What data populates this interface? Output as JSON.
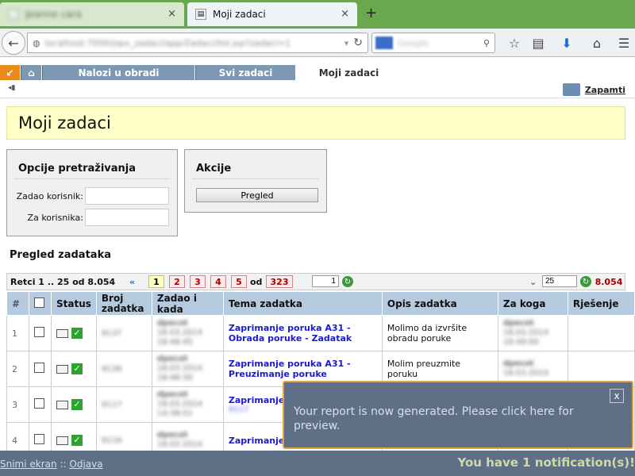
{
  "browser": {
    "tabs": [
      {
        "title": "Jeanne cara",
        "close": "×"
      },
      {
        "title": "Moji zadaci",
        "close": "×"
      }
    ],
    "new_tab": "+",
    "url": "localhost:7000/jspx_zadaci/app/Zadaci/list.jsp?zadaci=1",
    "search_placeholder": "Google"
  },
  "app_tabs": [
    {
      "label": "Nalozi u obradi"
    },
    {
      "label": "Svi zadaci"
    },
    {
      "label": "Moji zadaci"
    }
  ],
  "toolbar": {
    "save_label": "Zapamti"
  },
  "page_title": "Moji zadaci",
  "search_panel": {
    "title": "Opcije pretraživanja",
    "fields": [
      {
        "label": "Zadao korisnik:",
        "value": ""
      },
      {
        "label": "Za korisnika:",
        "value": ""
      }
    ]
  },
  "actions_panel": {
    "title": "Akcije",
    "button": "Pregled"
  },
  "section_title": "Pregled zadataka",
  "pager": {
    "rows_info": "Retci 1 .. 25 od 8.054",
    "pages": [
      "1",
      "2",
      "3",
      "4",
      "5"
    ],
    "of_label": "od",
    "total_pages": "323",
    "goto_value": "1",
    "page_size": "25",
    "total_rows": "8.054"
  },
  "table": {
    "columns": [
      "#",
      "",
      "Status",
      "Broj zadatka",
      "Zadao i kada",
      "Tema zadatka",
      "Opis zadatka",
      "Za koga",
      "Rješenje"
    ],
    "rows": [
      {
        "num": "1",
        "broj": "9137",
        "zadao": "dpecot",
        "kada": "18.03.2014 18:48:45",
        "tema": "Zaprimanje poruka A31 - Obrada poruke - Zadatak",
        "tema_extra": "",
        "opis": "Molimo da izvršite obradu poruke",
        "za": "dpecot",
        "za_kada": "18.03.2014 18:49:00"
      },
      {
        "num": "2",
        "broj": "9136",
        "zadao": "dpecot",
        "kada": "18.03.2014 18:48:30",
        "tema": "Zaprimanje poruka A31 - Preuzimanje poruke",
        "tema_extra": "",
        "opis": "Molim preuzmite poruku",
        "za": "dpecot",
        "za_kada": "18.03.2014"
      },
      {
        "num": "3",
        "broj": "9117",
        "zadao": "dpecot",
        "kada": "18.03.2014 14:38:51",
        "tema": "Zaprimanje p",
        "tema_extra": "9117",
        "opis": "",
        "za": "",
        "za_kada": ""
      },
      {
        "num": "4",
        "broj": "9116",
        "zadao": "dpecot",
        "kada": "18.03.2014",
        "tema": "Zaprimanje p",
        "tema_extra": "",
        "opis": "",
        "za": "",
        "za_kada": ""
      }
    ]
  },
  "popup": {
    "message": "Your report is now generated. Please click here for preview.",
    "close": "x"
  },
  "footer": {
    "snimi": "Snimi ekran",
    "sep": "::",
    "odjava": "Odjava",
    "notification": "You have 1 notification(s)!"
  }
}
